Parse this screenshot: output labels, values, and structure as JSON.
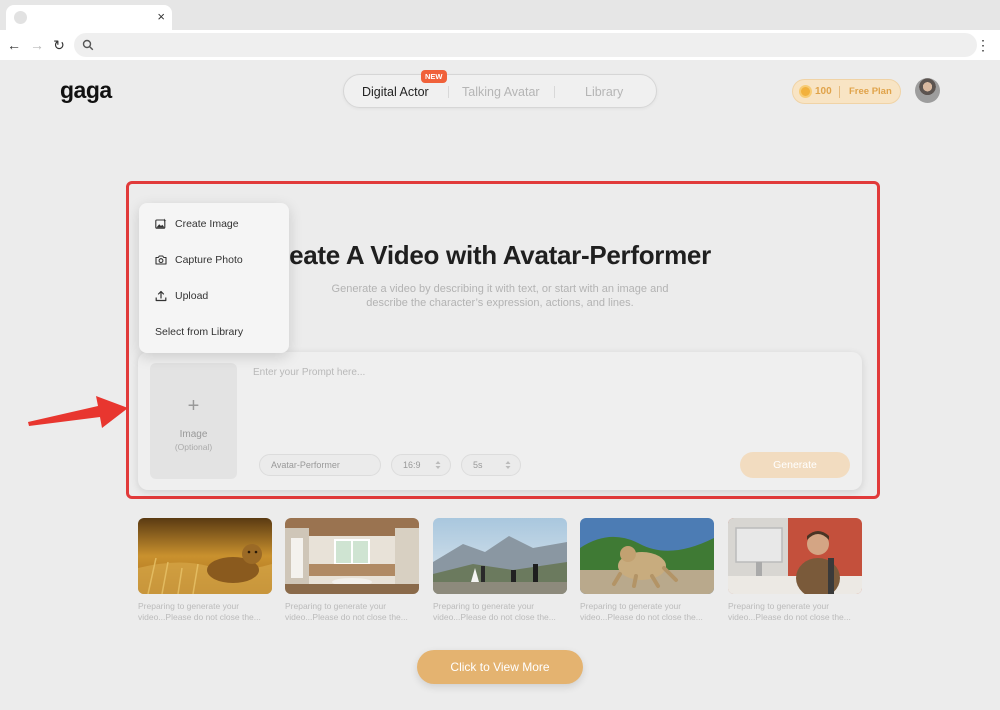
{
  "browser": {
    "tab_close": "×",
    "back": "←",
    "forward": "→",
    "reload": "↻",
    "menu": "⋮",
    "url": ""
  },
  "header": {
    "logo": "gaga",
    "tabs": [
      {
        "label": "Digital Actor",
        "active": true
      },
      {
        "label": "Talking Avatar",
        "active": false
      },
      {
        "label": "Library",
        "active": false
      }
    ],
    "new_badge": "NEW",
    "credits": "100",
    "plan": "Free Plan"
  },
  "main": {
    "headline": "eate A Video with Avatar-Performer",
    "subline_1": "Generate a video by describing it with text, or start with an image and",
    "subline_2": "describe the character’s expression, actions, and lines.",
    "image_slot": {
      "plus": "+",
      "label": "Image",
      "optional": "(Optional)"
    },
    "prompt_placeholder": "Enter your Prompt here...",
    "model": "Avatar-Performer",
    "ratio": "16:9",
    "duration": "5s",
    "generate": "Generate"
  },
  "dropdown": {
    "items": [
      {
        "label": "Create Image",
        "icon": "image-create-icon"
      },
      {
        "label": "Capture Photo",
        "icon": "camera-icon"
      },
      {
        "label": "Upload",
        "icon": "upload-icon"
      },
      {
        "label": "Select from Library",
        "icon": ""
      }
    ]
  },
  "gallery": {
    "items": [
      {
        "caption": "Preparing to generate your video...Please do not close the...",
        "scene": "cheetah"
      },
      {
        "caption": "Preparing to generate your video...Please do not close the...",
        "scene": "kitchen"
      },
      {
        "caption": "Preparing to generate your video...Please do not close the...",
        "scene": "mountain-couple"
      },
      {
        "caption": "Preparing to generate your video...Please do not close the...",
        "scene": "monkey"
      },
      {
        "caption": "Preparing to generate your video...Please do not close the...",
        "scene": "office-man"
      }
    ],
    "view_more": "Click to View More"
  },
  "colors": {
    "highlight": "#e13a3a",
    "accent": "#e4b370",
    "badge": "#f0613a"
  }
}
